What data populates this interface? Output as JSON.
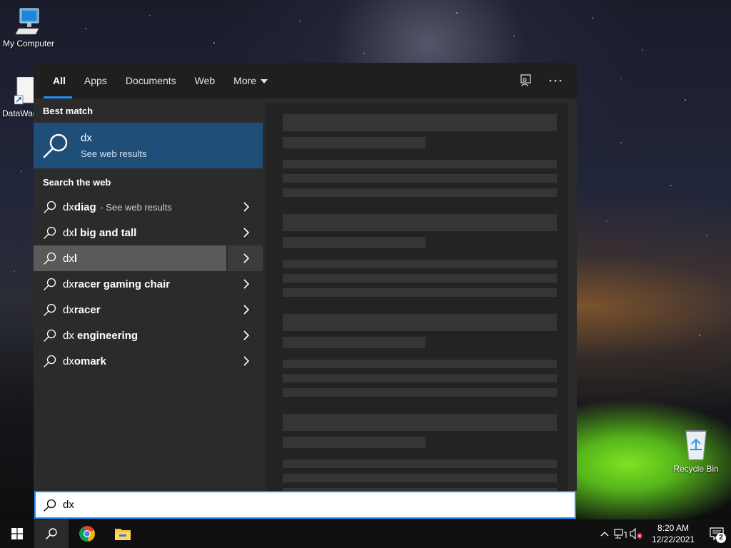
{
  "desktop": {
    "icons": [
      {
        "label": "My Computer"
      },
      {
        "label": "DataWag"
      },
      {
        "label": "Recycle Bin"
      }
    ]
  },
  "search_panel": {
    "tabs": [
      "All",
      "Apps",
      "Documents",
      "Web",
      "More"
    ],
    "best_match_heading": "Best match",
    "best_match": {
      "title": "dx",
      "subtitle": "See web results"
    },
    "search_web_heading": "Search the web",
    "suggestions": [
      {
        "prefix": "dx",
        "bold": "diag",
        "suffix": " - See web results"
      },
      {
        "prefix": "dx",
        "bold": "l big and tall",
        "suffix": ""
      },
      {
        "prefix": "dx",
        "bold": "l",
        "suffix": ""
      },
      {
        "prefix": "dx",
        "bold": "racer gaming chair",
        "suffix": ""
      },
      {
        "prefix": "dx",
        "bold": "racer",
        "suffix": ""
      },
      {
        "prefix": "dx",
        "bold": " engineering",
        "suffix": ""
      },
      {
        "prefix": "dx",
        "bold": "omark",
        "suffix": ""
      }
    ],
    "selected_index": 2,
    "query": "dx"
  },
  "taskbar": {
    "time": "8:20 AM",
    "date": "12/22/2021",
    "notification_count": "2",
    "pinned": [
      "windows-start-icon",
      "search-icon",
      "chrome-icon",
      "file-explorer-icon"
    ]
  },
  "colors": {
    "accent": "#1e90ff",
    "best_match_bg": "#1f4e79",
    "selected_row_bg": "#5a5a5a"
  }
}
